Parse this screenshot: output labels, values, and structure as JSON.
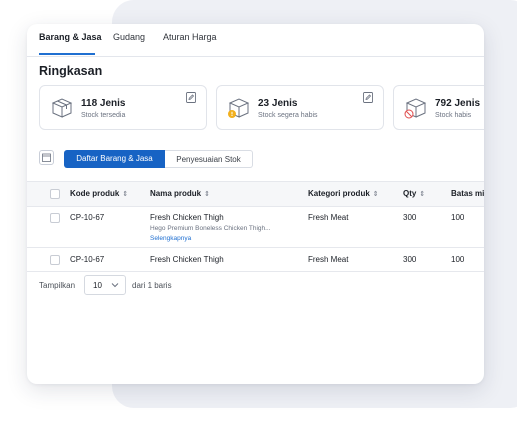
{
  "tabs": [
    {
      "label": "Barang & Jasa"
    },
    {
      "label": "Gudang"
    },
    {
      "label": "Aturan Harga"
    }
  ],
  "summary": {
    "title": "Ringkasan",
    "cards": [
      {
        "count": "118 Jenis",
        "label": "Stock tersedia",
        "icon": "box-icon"
      },
      {
        "count": "23 Jenis",
        "label": "Stock segera habis",
        "icon": "box-warning-icon"
      },
      {
        "count": "792 Jenis",
        "label": "Stock habis",
        "icon": "box-empty-icon"
      }
    ]
  },
  "toolbar": {
    "primary_label": "Daftar Barang & Jasa",
    "secondary_label": "Penyesuaian Stok"
  },
  "table": {
    "headers": {
      "code": "Kode produk",
      "name": "Nama produk",
      "category": "Kategori produk",
      "qty": "Qty",
      "limit": "Batas mi"
    },
    "sort_symbol": "⇕",
    "rows": [
      {
        "code": "CP-10-67",
        "name": "Fresh Chicken Thigh",
        "desc": "Hego Premium Boneless Chicken Thigh...",
        "more": "Selengkapnya",
        "category": "Fresh Meat",
        "qty": "300",
        "limit": "100"
      },
      {
        "code": "CP-10-67",
        "name": "Fresh Chicken Thigh",
        "category": "Fresh Meat",
        "qty": "300",
        "limit": "100"
      }
    ]
  },
  "pagination": {
    "show_label": "Tampilkan",
    "page_size": "10",
    "total_label": "dari 1 baris"
  },
  "colors": {
    "accent": "#1763c4",
    "link": "#1f6fd1",
    "warning": "#f2b01e",
    "danger": "#e04b4b"
  }
}
